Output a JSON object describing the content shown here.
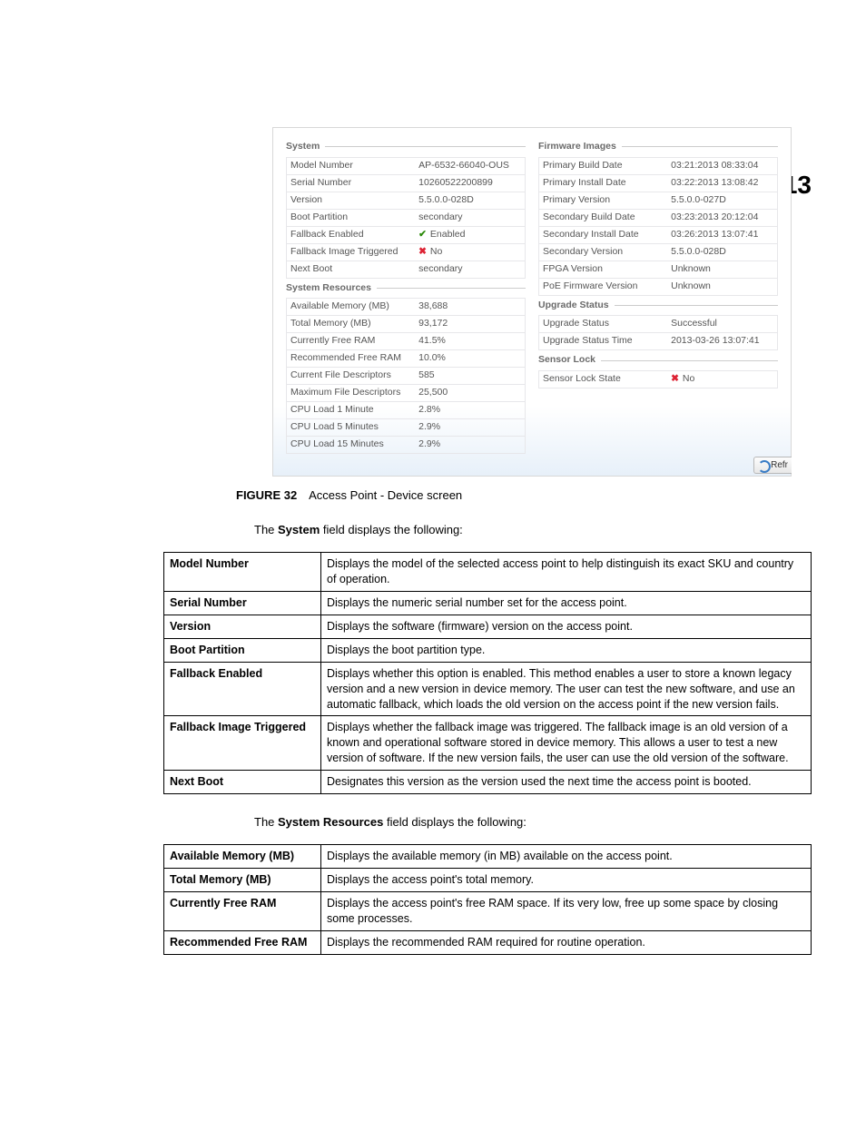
{
  "page_number": "13",
  "screenshot": {
    "refresh_label": "Refr",
    "system": {
      "title": "System",
      "rows": [
        {
          "k": "Model Number",
          "v": "AP-6532-66040-OUS"
        },
        {
          "k": "Serial Number",
          "v": "10260522200899"
        },
        {
          "k": "Version",
          "v": "5.5.0.0-028D"
        },
        {
          "k": "Boot Partition",
          "v": "secondary"
        },
        {
          "k": "Fallback Enabled",
          "v": "Enabled",
          "icon": "ok"
        },
        {
          "k": "Fallback Image Triggered",
          "v": "No",
          "icon": "x"
        },
        {
          "k": "Next Boot",
          "v": "secondary"
        }
      ]
    },
    "system_resources": {
      "title": "System Resources",
      "rows": [
        {
          "k": "Available Memory (MB)",
          "v": "38,688"
        },
        {
          "k": "Total Memory (MB)",
          "v": "93,172"
        },
        {
          "k": "Currently Free RAM",
          "v": "41.5%"
        },
        {
          "k": "Recommended Free RAM",
          "v": "10.0%"
        },
        {
          "k": "Current File Descriptors",
          "v": "585"
        },
        {
          "k": "Maximum File Descriptors",
          "v": "25,500"
        },
        {
          "k": "CPU Load 1 Minute",
          "v": "2.8%"
        },
        {
          "k": "CPU Load 5 Minutes",
          "v": "2.9%"
        },
        {
          "k": "CPU Load 15 Minutes",
          "v": "2.9%"
        }
      ]
    },
    "firmware_images": {
      "title": "Firmware Images",
      "rows": [
        {
          "k": "Primary Build Date",
          "v": "03:21:2013 08:33:04"
        },
        {
          "k": "Primary Install Date",
          "v": "03:22:2013 13:08:42"
        },
        {
          "k": "Primary Version",
          "v": "5.5.0.0-027D"
        },
        {
          "k": "Secondary Build Date",
          "v": "03:23:2013 20:12:04"
        },
        {
          "k": "Secondary Install Date",
          "v": "03:26:2013 13:07:41"
        },
        {
          "k": "Secondary Version",
          "v": "5.5.0.0-028D"
        },
        {
          "k": "FPGA Version",
          "v": "Unknown"
        },
        {
          "k": "PoE Firmware Version",
          "v": "Unknown"
        }
      ]
    },
    "upgrade_status": {
      "title": "Upgrade Status",
      "rows": [
        {
          "k": "Upgrade Status",
          "v": "Successful"
        },
        {
          "k": "Upgrade Status Time",
          "v": "2013-03-26 13:07:41"
        }
      ]
    },
    "sensor_lock": {
      "title": "Sensor Lock",
      "rows": [
        {
          "k": "Sensor Lock State",
          "v": "No",
          "icon": "x"
        }
      ]
    }
  },
  "caption": {
    "label": "FIGURE 32",
    "text": "Access Point - Device screen"
  },
  "intro1": {
    "pre": "The ",
    "bold": "System",
    "post": " field displays the following:"
  },
  "table1": [
    {
      "term": "Model Number",
      "desc": "Displays the model of the selected access point to help distinguish its exact SKU and country of operation."
    },
    {
      "term": "Serial Number",
      "desc": "Displays the numeric serial number set for the access point."
    },
    {
      "term": "Version",
      "desc": "Displays the software (firmware) version on the access point."
    },
    {
      "term": "Boot Partition",
      "desc": "Displays the boot partition type."
    },
    {
      "term": "Fallback Enabled",
      "desc": "Displays whether this option is enabled. This method enables a user to store a known legacy version and a new version in device memory. The user can test the new software, and use an automatic fallback, which loads the old version on the access point if the new version fails."
    },
    {
      "term": "Fallback Image Triggered",
      "desc": "Displays whether the fallback image was triggered. The fallback image is an old version of a known and operational software stored in device memory. This allows a user to test a new version of software. If the new version fails, the user can use the old version of the software."
    },
    {
      "term": "Next Boot",
      "desc": "Designates this version as the version used the next time the access point is booted."
    }
  ],
  "intro2": {
    "pre": "The ",
    "bold": "System Resources",
    "post": " field displays the following:"
  },
  "table2": [
    {
      "term": "Available Memory (MB)",
      "desc": "Displays the available memory (in MB) available on the access point."
    },
    {
      "term": "Total Memory (MB)",
      "desc": "Displays the access point's total memory."
    },
    {
      "term": "Currently Free RAM",
      "desc": "Displays the access point's free RAM space. If its very low, free up some space by closing some processes."
    },
    {
      "term": "Recommended Free RAM",
      "desc": "Displays the recommended RAM required for routine operation."
    }
  ]
}
